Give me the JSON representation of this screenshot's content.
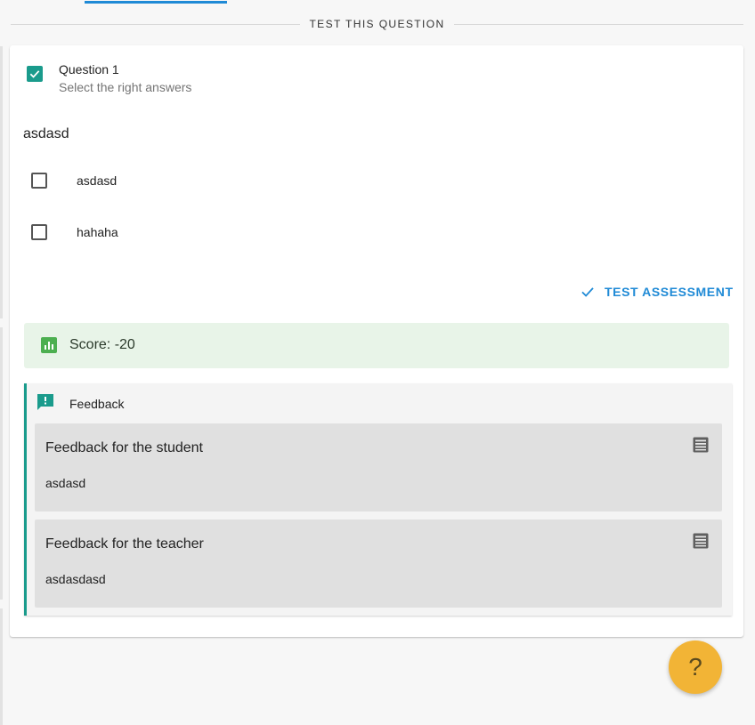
{
  "section": {
    "divider_label": "TEST THIS QUESTION"
  },
  "question": {
    "title": "Question 1",
    "subtitle": "Select the right answers",
    "body": "asdasd",
    "checked": true,
    "options": [
      {
        "label": "asdasd",
        "checked": false
      },
      {
        "label": "hahaha",
        "checked": false
      }
    ]
  },
  "actions": {
    "test_label": "TEST ASSESSMENT"
  },
  "score": {
    "text": "Score: -20",
    "icon": "bar-chart-icon"
  },
  "feedback": {
    "title": "Feedback",
    "icon": "feedback-icon",
    "items": [
      {
        "title": "Feedback for the student",
        "text": "asdasd",
        "icon": "notes-icon"
      },
      {
        "title": "Feedback for the teacher",
        "text": "asdasdasd",
        "icon": "notes-icon"
      }
    ]
  },
  "help": {
    "label": "?"
  },
  "colors": {
    "accent": "#1f8ad6",
    "teal": "#1a9b8c",
    "score_bg": "#e8f4e8",
    "score_icon": "#4caf50",
    "help_fab": "#f2b436"
  }
}
